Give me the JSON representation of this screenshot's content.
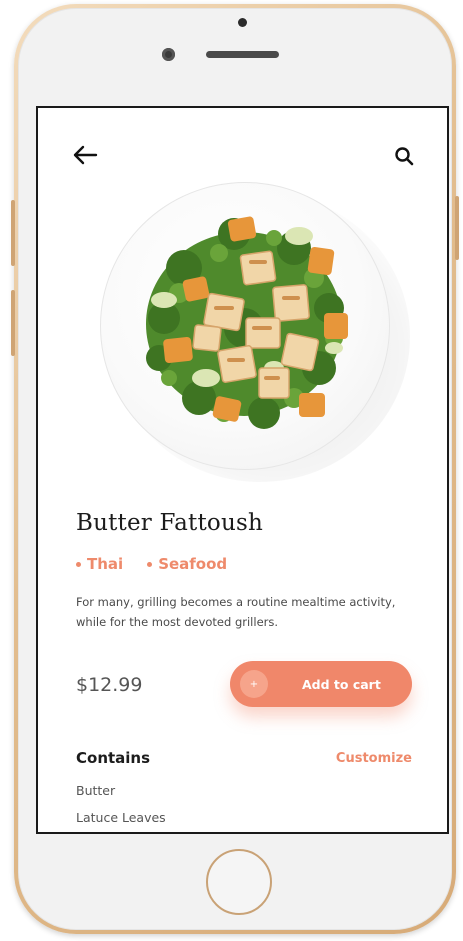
{
  "colors": {
    "accent": "#ee8a6b",
    "button": "#f0876a",
    "text_dark": "#1c1c1c",
    "frame_gold": "#dcb483"
  },
  "header": {
    "back_icon": "arrow-left-icon",
    "search_icon": "search-icon"
  },
  "product": {
    "image": "salad-bowl",
    "title": "Butter Fattoush",
    "tags": [
      "Thai",
      "Seafood"
    ],
    "description": "For many, grilling becomes a routine mealtime activity, while for the most devoted grillers.",
    "price": "$12.99"
  },
  "cart_button": {
    "icon": "+",
    "label": "Add to cart"
  },
  "contains": {
    "title": "Contains",
    "action": "Customize",
    "ingredients": [
      "Butter",
      "Latuce Leaves"
    ]
  }
}
